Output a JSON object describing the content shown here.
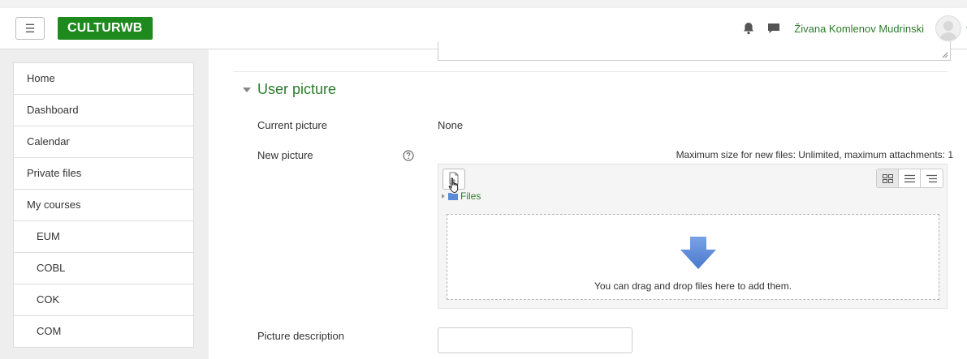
{
  "navbar": {
    "menu_icon": "hamburger-icon",
    "brand": "CULTURWB",
    "user_name": "Živana Komlenov Mudrinski",
    "icons": {
      "bell": "bell-icon",
      "messages": "chat-icon",
      "caret": "chevron-down-icon"
    }
  },
  "sidebar": {
    "items": [
      {
        "label": "Home"
      },
      {
        "label": "Dashboard"
      },
      {
        "label": "Calendar"
      },
      {
        "label": "Private files"
      },
      {
        "label": "My courses"
      },
      {
        "label": "EUM"
      },
      {
        "label": "COBL"
      },
      {
        "label": "COK"
      },
      {
        "label": "COM"
      }
    ]
  },
  "section": {
    "title": "User picture"
  },
  "form": {
    "current_picture_label": "Current picture",
    "current_picture_value": "None",
    "new_picture_label": "New picture",
    "max_size_text": "Maximum size for new files: Unlimited, maximum attachments: 1",
    "files_label": "Files",
    "drop_text": "You can drag and drop files here to add them.",
    "picture_description_label": "Picture description",
    "picture_description_value": ""
  },
  "colors": {
    "brand_bg": "#1e8a1e",
    "link_green": "#2c7a2c",
    "arrow_blue": "#5b8ad6"
  }
}
